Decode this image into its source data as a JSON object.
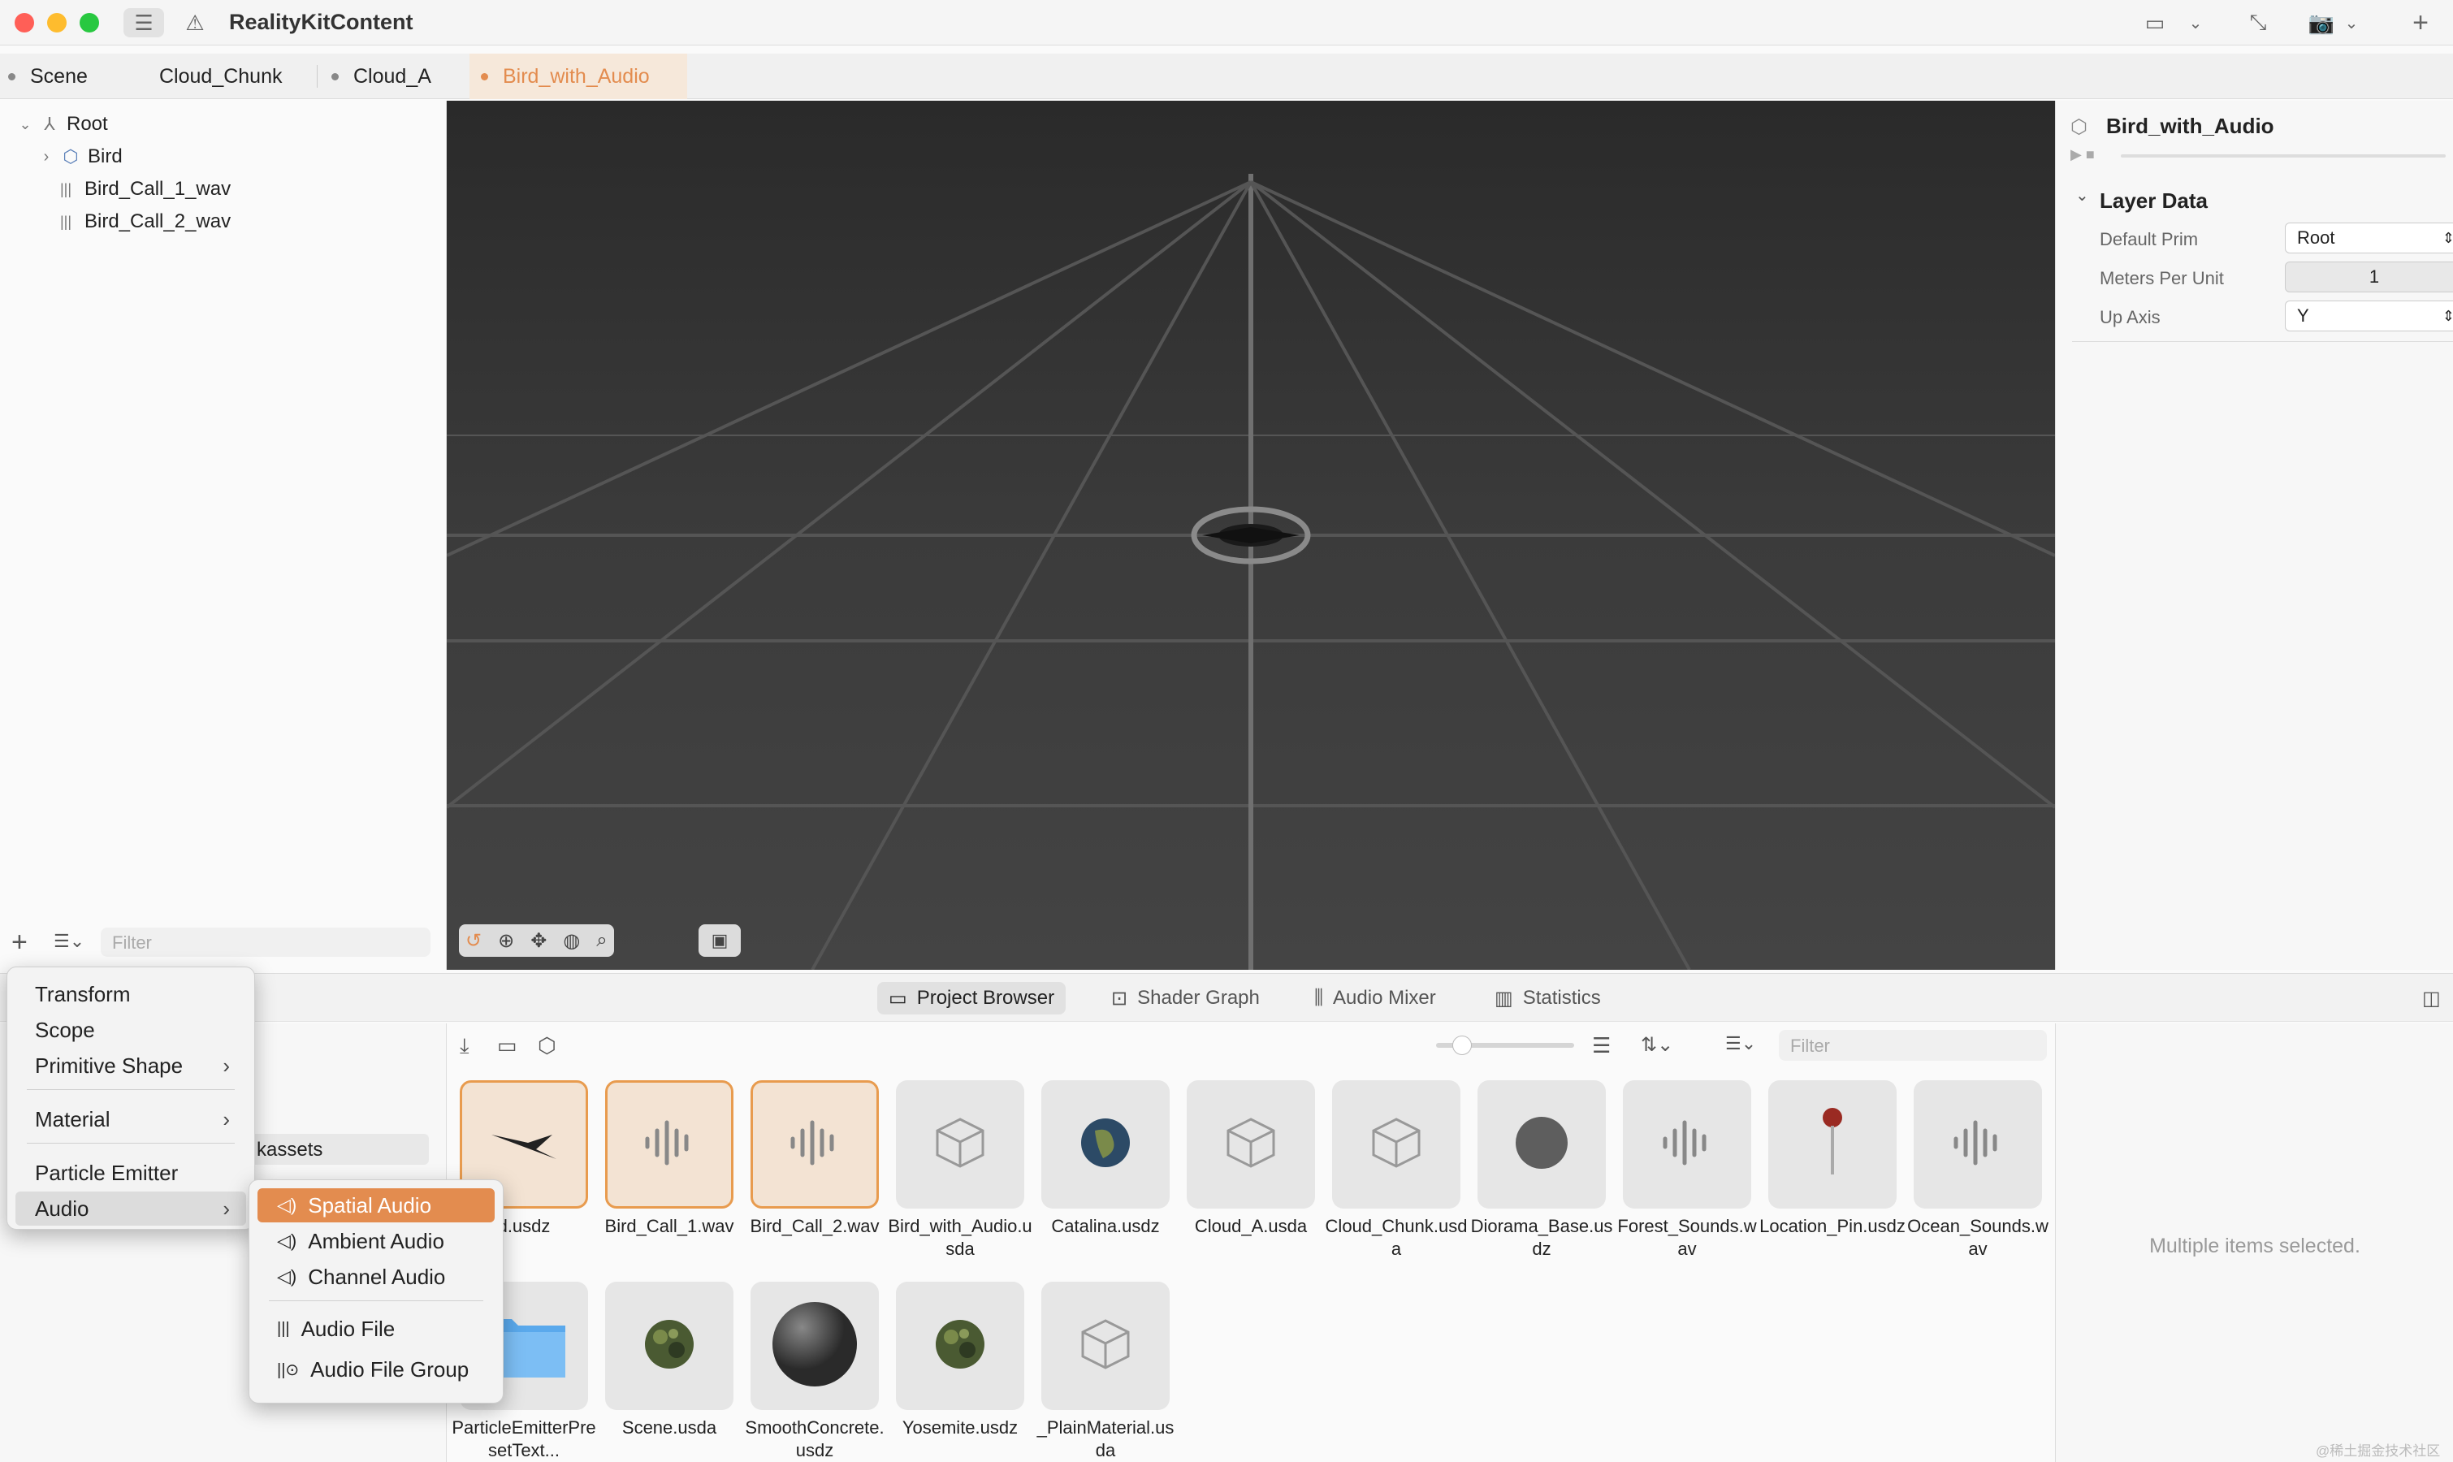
{
  "window": {
    "title": "RealityKitContent"
  },
  "tabs": [
    {
      "label": "Scene"
    },
    {
      "label": "Cloud_Chunk"
    },
    {
      "label": "Cloud_A"
    },
    {
      "label": "Bird_with_Audio",
      "active": true
    }
  ],
  "outliner": {
    "items": [
      {
        "label": "Root",
        "icon": "root-icon"
      },
      {
        "label": "Bird",
        "icon": "model-icon"
      },
      {
        "label": "Bird_Call_1_wav",
        "icon": "audio-icon"
      },
      {
        "label": "Bird_Call_2_wav",
        "icon": "audio-icon"
      }
    ],
    "filter_placeholder": "Filter"
  },
  "inspector": {
    "title": "Bird_with_Audio",
    "section": "Layer Data",
    "fields": [
      {
        "label": "Default Prim",
        "value": "Root"
      },
      {
        "label": "Meters Per Unit",
        "value": "1"
      },
      {
        "label": "Up Axis",
        "value": "Y"
      }
    ]
  },
  "bottom_tabs": [
    {
      "label": "Project Browser",
      "active": true
    },
    {
      "label": "Shader Graph"
    },
    {
      "label": "Audio Mixer"
    },
    {
      "label": "Statistics"
    }
  ],
  "browser": {
    "filter_placeholder": "Filter",
    "left_item": "kassets",
    "assets_row1": [
      {
        "label": "d.usdz",
        "kind": "bird",
        "selected": true
      },
      {
        "label": "Bird_Call_1.wav",
        "kind": "audio",
        "selected": true
      },
      {
        "label": "Bird_Call_2.wav",
        "kind": "audio",
        "selected": true
      },
      {
        "label": "Bird_with_Audio.usda",
        "kind": "cube"
      },
      {
        "label": "Catalina.usdz",
        "kind": "globe"
      },
      {
        "label": "Cloud_A.usda",
        "kind": "cube"
      },
      {
        "label": "Cloud_Chunk.usda",
        "kind": "cube"
      },
      {
        "label": "Diorama_Base.usdz",
        "kind": "disc"
      },
      {
        "label": "Forest_Sounds.wav",
        "kind": "audio"
      },
      {
        "label": "Location_Pin.usdz",
        "kind": "pin"
      },
      {
        "label": "Ocean_Sounds.wav",
        "kind": "audio"
      }
    ],
    "assets_row2": [
      {
        "label": "ParticleEmitterPresetText...",
        "kind": "folder"
      },
      {
        "label": "Scene.usda",
        "kind": "camo"
      },
      {
        "label": "SmoothConcrete.usdz",
        "kind": "sphere"
      },
      {
        "label": "Yosemite.usdz",
        "kind": "camo"
      },
      {
        "label": "_PlainMaterial.usda",
        "kind": "cube"
      }
    ],
    "detail_text": "Multiple items selected."
  },
  "add_menu": {
    "items": [
      "Transform",
      "Scope",
      "Primitive Shape",
      "Material",
      "Particle Emitter",
      "Audio"
    ]
  },
  "audio_submenu": {
    "items": [
      "Spatial Audio",
      "Ambient Audio",
      "Channel Audio",
      "Audio File",
      "Audio File Group"
    ]
  },
  "watermark": "@稀土掘金技术社区",
  "colors": {
    "accent": "#e38c4f",
    "selection": "#e89b4e"
  }
}
